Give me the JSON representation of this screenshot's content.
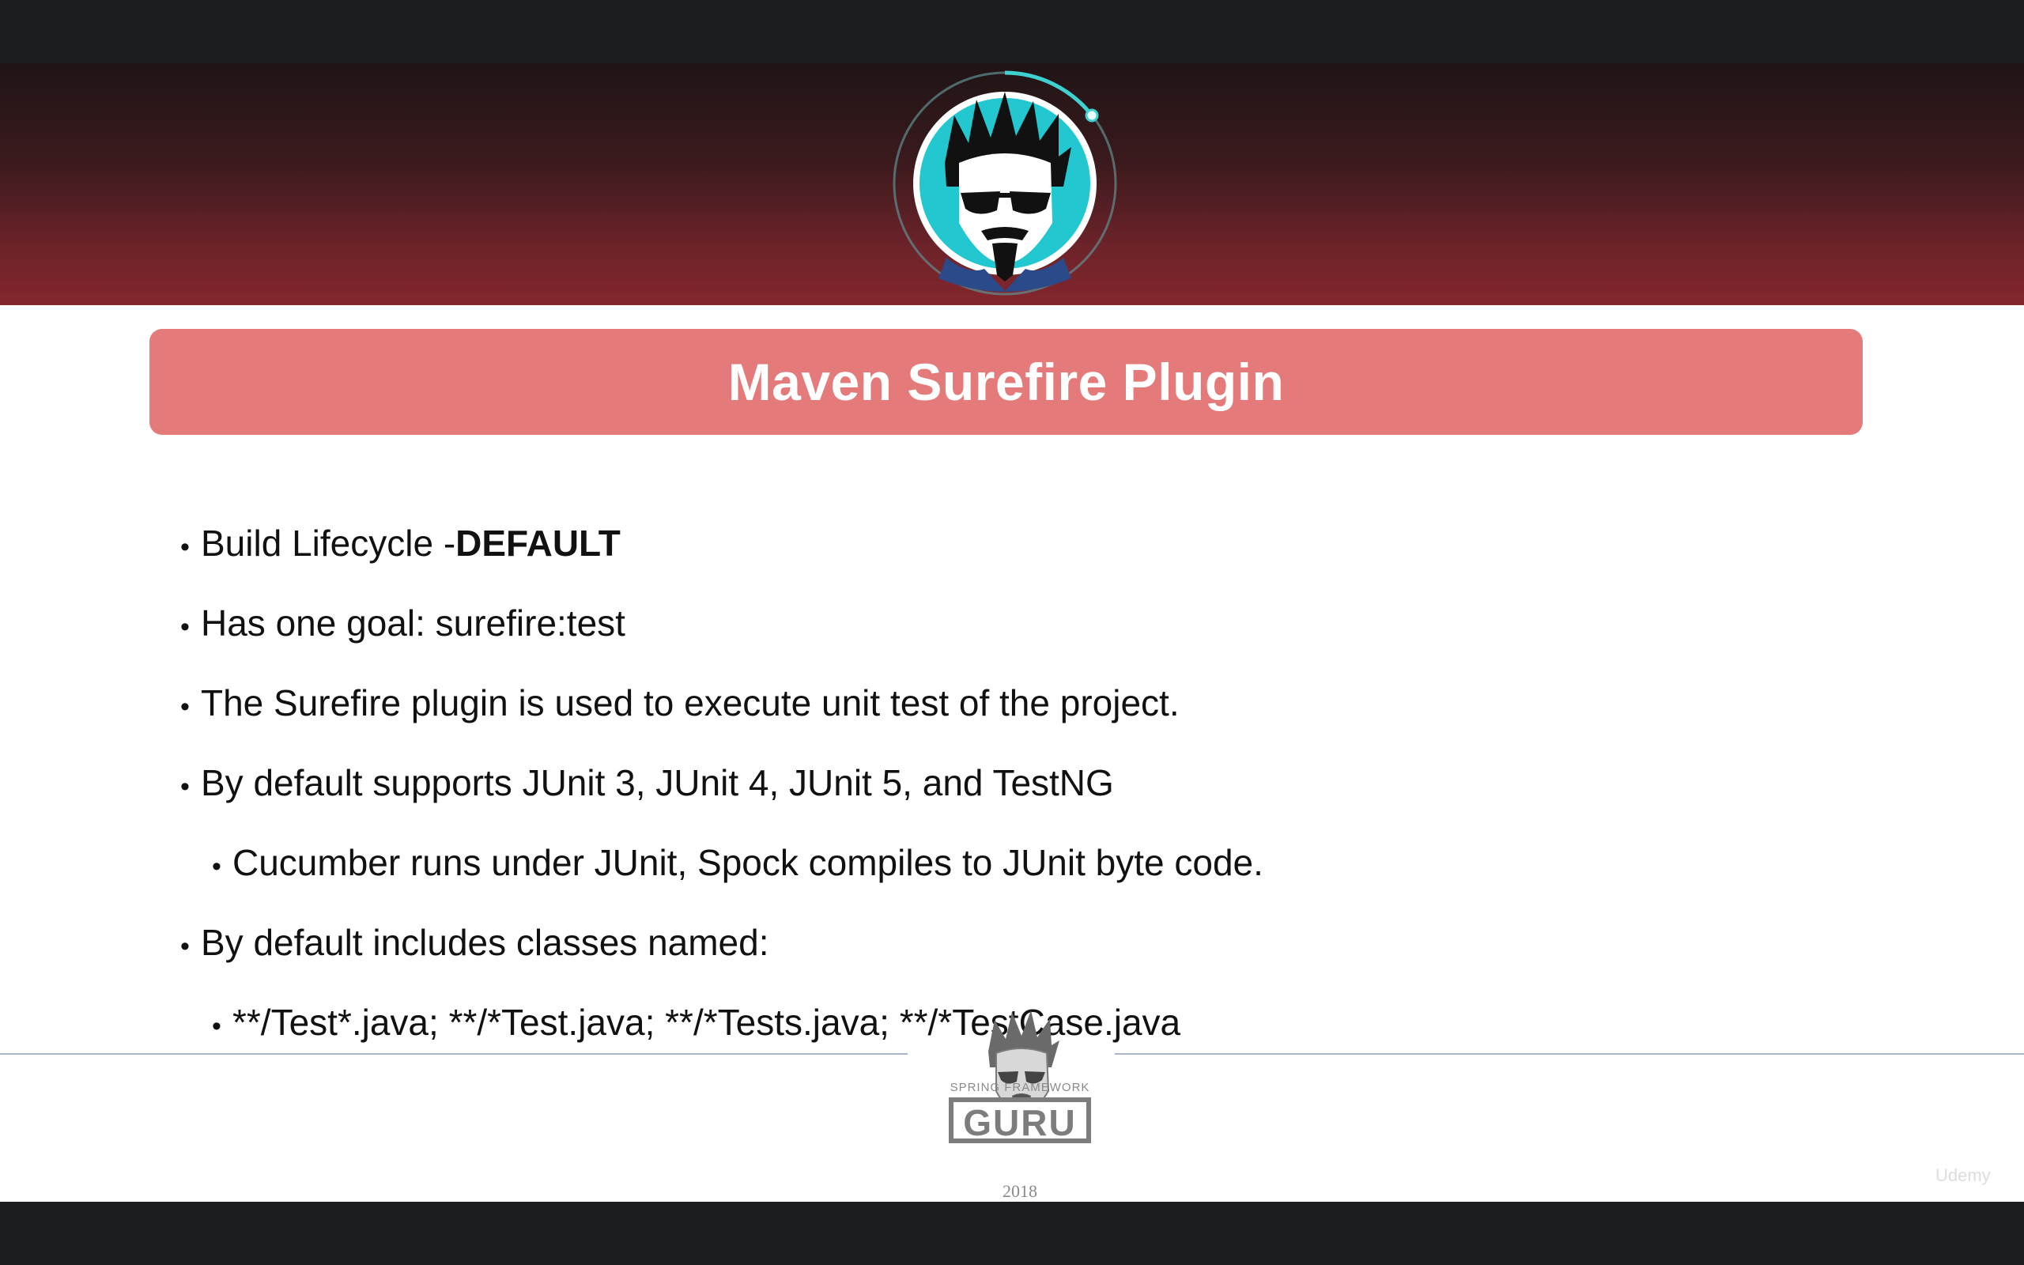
{
  "slide": {
    "title": "Maven Surefire Plugin",
    "bullets": [
      {
        "text": "Build Lifecycle - ",
        "bold": "DEFAULT"
      },
      {
        "text": "Has one goal: surefire:test"
      },
      {
        "text": "The Surefire plugin is used to execute unit test of the project."
      },
      {
        "text": "By default supports JUnit 3, JUnit 4, JUnit 5, and TestNG"
      },
      {
        "text": "Cucumber runs under JUnit, Spock compiles to JUnit byte code."
      },
      {
        "text": "By default includes classes named:"
      },
      {
        "text": "**/Test*.java; **/*Test.java; **/*Tests.java; **/*TestCase.java"
      }
    ],
    "footer": {
      "logo_top": "SPRING FRAMEWORK",
      "logo_main": "GURU",
      "year": "2018"
    },
    "watermark": "Udemy"
  },
  "colors": {
    "title_bg": "#e57a7b",
    "banner_dark": "#1f1415",
    "banner_red": "#84262d",
    "accent_teal": "#2bc4c4"
  }
}
